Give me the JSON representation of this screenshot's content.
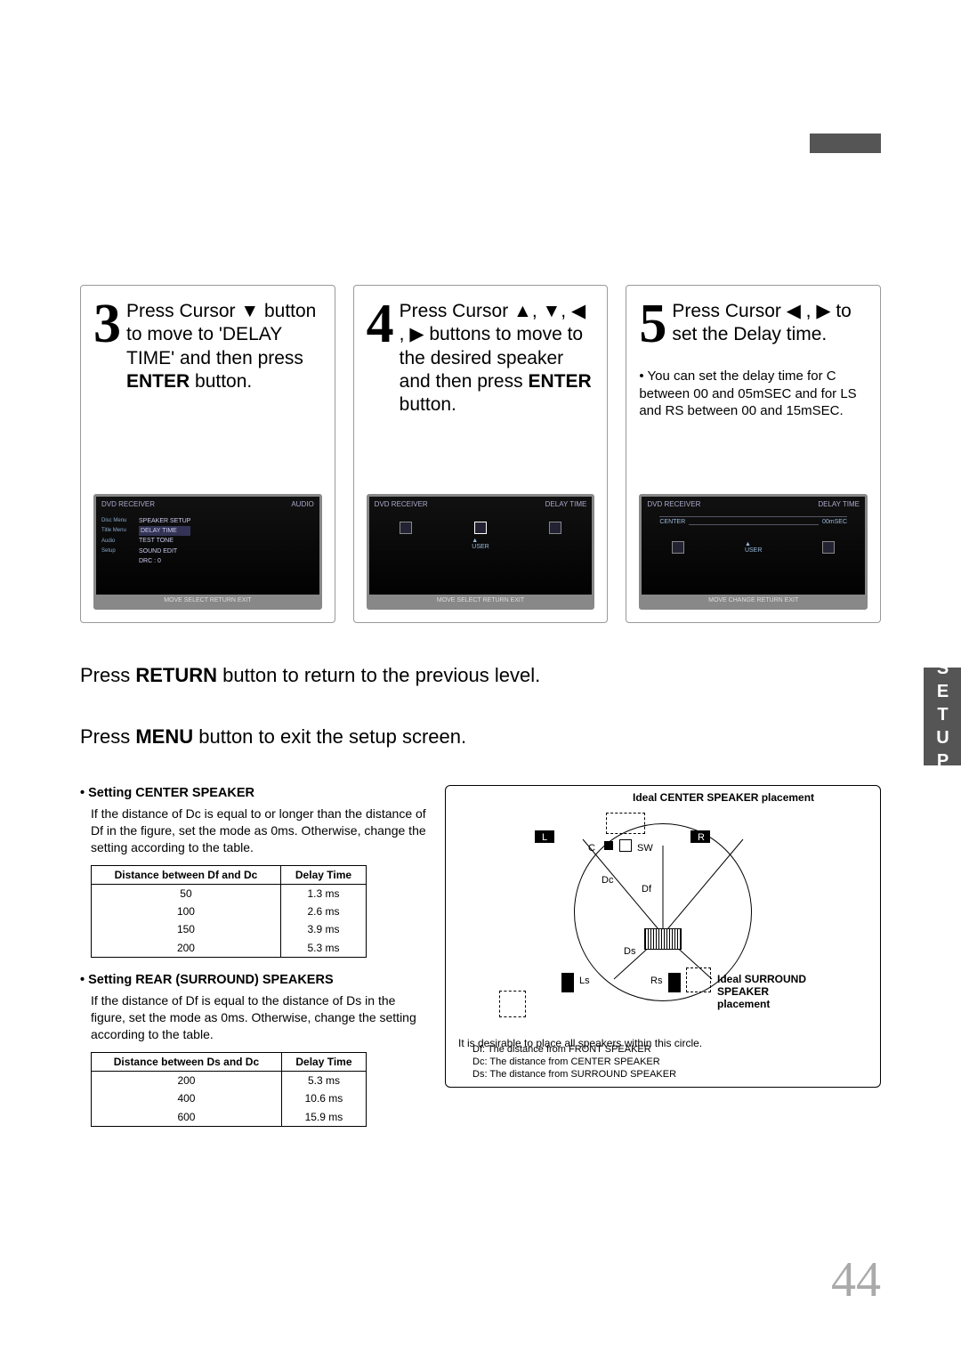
{
  "side_tab": "SETUP",
  "page_number": "44",
  "steps": [
    {
      "num": "3",
      "text_pre": "Press Cursor ▼ button to move to 'DELAY TIME' and then press ",
      "text_bold": "ENTER",
      "text_post": " button.",
      "screen": {
        "title_left": "DVD RECEIVER",
        "title_right": "AUDIO",
        "side": [
          "Disc Menu",
          "Title Menu",
          "Audio",
          "Setup"
        ],
        "menu": [
          "SPEAKER SETUP",
          "DELAY TIME",
          "TEST TONE",
          "SOUND EDIT",
          "DRC            : 0"
        ],
        "bot": "MOVE   SELECT   RETURN   EXIT"
      }
    },
    {
      "num": "4",
      "text_pre": "Press Cursor ▲, ▼, ◀ , ▶ buttons to move to the desired speaker and then press ",
      "text_bold": "ENTER",
      "text_post": " button.",
      "screen": {
        "title_left": "DVD RECEIVER",
        "title_right": "DELAY TIME",
        "bot": "MOVE   SELECT   RETURN   EXIT"
      }
    },
    {
      "num": "5",
      "text_pre": "Press Cursor ◀ , ▶ to set the Delay time.",
      "text_bold": "",
      "text_post": "",
      "note": "You can set the delay time for C between 00 and 05mSEC and for LS and RS between 00 and 15mSEC.",
      "screen": {
        "title_left": "DVD RECEIVER",
        "title_right": "DELAY TIME",
        "center_label": "CENTER",
        "center_val": "00mSEC",
        "bot": "MOVE   CHANGE   RETURN   EXIT"
      }
    }
  ],
  "mid": {
    "return_pre": "Press ",
    "return_bold": "RETURN",
    "return_post": " button to return to the previous level.",
    "menu_pre": "Press ",
    "menu_bold": "MENU",
    "menu_post": " button to exit the setup screen."
  },
  "center_sec": {
    "title": "Setting CENTER SPEAKER",
    "para": "If the distance of Dc is equal to or longer than the distance of Df in the figure, set the mode as 0ms. Otherwise, change the setting according to the table.",
    "th1": "Distance between Df and Dc",
    "th2": "Delay Time",
    "rows": [
      {
        "d": "50",
        "t": "1.3 ms"
      },
      {
        "d": "100",
        "t": "2.6 ms"
      },
      {
        "d": "150",
        "t": "3.9 ms"
      },
      {
        "d": "200",
        "t": "5.3 ms"
      }
    ]
  },
  "rear_sec": {
    "title": "Setting REAR (SURROUND) SPEAKERS",
    "para": "If the distance of Df is equal to the distance of Ds in the figure, set the mode as 0ms. Otherwise, change the setting according to the table.",
    "th1": "Distance between Ds and Dc",
    "th2": "Delay Time",
    "rows": [
      {
        "d": "200",
        "t": "5.3 ms"
      },
      {
        "d": "400",
        "t": "10.6 ms"
      },
      {
        "d": "600",
        "t": "15.9 ms"
      }
    ]
  },
  "diagram": {
    "ideal_center": "Ideal CENTER SPEAKER placement",
    "ideal_surround": "Ideal SURROUND SPEAKER placement",
    "L": "L",
    "C": "C",
    "SW": "SW",
    "R": "R",
    "Dc": "Dc",
    "Df": "Df",
    "Ds": "Ds",
    "Ls": "Ls",
    "Rs": "Rs",
    "note": "It is desirable to place all speakers within this circle.",
    "legend": [
      "Df: The distance from FRONT SPEAKER",
      "Dc: The distance from CENTER SPEAKER",
      "Ds: The distance from SURROUND SPEAKER"
    ]
  }
}
